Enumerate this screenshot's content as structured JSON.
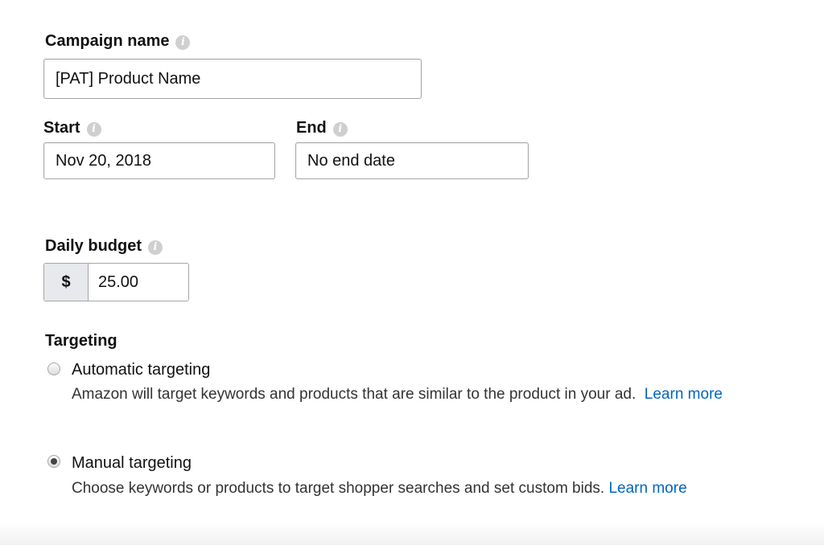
{
  "campaign": {
    "name_label": "Campaign name",
    "name_value": "[PAT] Product Name"
  },
  "dates": {
    "start_label": "Start",
    "start_value": "Nov 20, 2018",
    "end_label": "End",
    "end_value": "No end date"
  },
  "budget": {
    "label": "Daily budget",
    "currency_symbol": "$",
    "value": "25.00"
  },
  "targeting": {
    "heading": "Targeting",
    "options": [
      {
        "label": "Automatic targeting",
        "description": "Amazon will target keywords and products that are similar to the product in your ad.",
        "link_text": "Learn more",
        "selected": false
      },
      {
        "label": "Manual targeting",
        "description": "Choose keywords or products to target shopper searches and set custom bids.",
        "link_text": "Learn more",
        "selected": true
      }
    ]
  },
  "icons": {
    "info": "info-icon",
    "info_glyph": "i"
  },
  "colors": {
    "link": "#0066c0",
    "input_border": "#a6a6a6",
    "currency_bg": "#e7e9ec"
  }
}
